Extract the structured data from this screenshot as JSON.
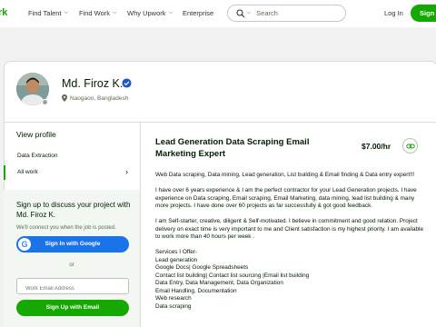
{
  "header": {
    "logo": "rk",
    "nav": [
      "Find Talent",
      "Find Work",
      "Why Upwork",
      "Enterprise"
    ],
    "search_placeholder": "Search",
    "login": "Log In",
    "signup": "Sign"
  },
  "profile": {
    "name": "Md. Firoz K.",
    "location": "Naogaon, Bangladesh"
  },
  "sidebar": {
    "title": "View profile",
    "items": [
      "Data Extraction",
      "All work"
    ]
  },
  "signup_box": {
    "title": "Sign up to discuss your project with Md. Firoz K.",
    "subtitle": "We'll connect you when the job is posted.",
    "google_label": "Sign In with Google",
    "or": "or",
    "email_placeholder": "Work Email Address",
    "email_button": "Sign Up with Email"
  },
  "job": {
    "title": "Lead Generation Data Scraping Email Marketing Expert",
    "rate": "$7.00/hr",
    "paragraphs": [
      "Web Data scraping, Data mining, Lead generation, List building & Email finding & Data entry expert!!!",
      "I have over 6 years experience & I am the perfect contractor for your Lead Generation projects. I have experience on Data scraping, Email scraping, Email Marketing, data mining, lead list building & many more projects. I have done over 60 projects as far successfully & got good feedback.",
      "I am Self-starter, creative, diligent & Self-motivated. I believe in commitment and good relation. Project delivery on exact time is very important to me and Client satisfaction is my highest priority. I am available to work more than 40 hours per week ."
    ],
    "services": [
      "Services I Offer-",
      "Lead generation",
      "Google Docs| Google Spreadsheets",
      "Contact list building| Contact list sourcing |Email list building",
      "Data Entry, Data Management, Data Organization",
      "Email Handling, Documentation",
      "Web research",
      "Data scraping"
    ]
  },
  "colors": {
    "brand": "#14a800",
    "google": "#1a73e8",
    "verified": "#1f57c3"
  }
}
